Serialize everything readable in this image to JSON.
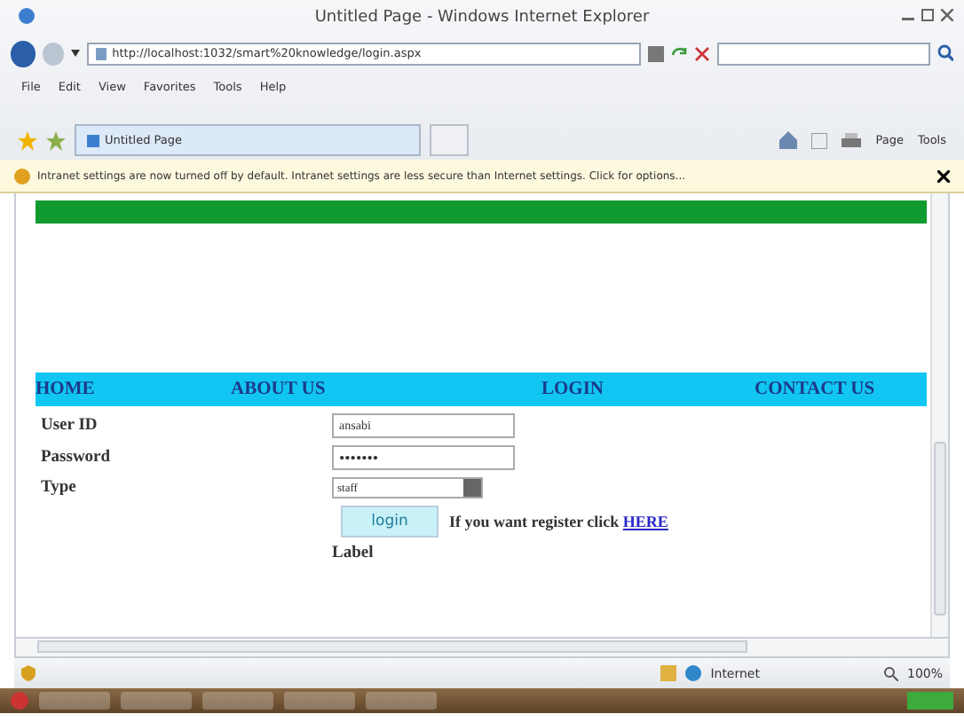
{
  "window": {
    "title": "Untitled Page - Windows Internet Explorer"
  },
  "address_bar": {
    "url": "http://localhost:1032/smart%20knowledge/login.aspx"
  },
  "menu": [
    "File",
    "Edit",
    "View",
    "Favorites",
    "Tools",
    "Help"
  ],
  "tab": {
    "title": "Untitled Page",
    "selected": true
  },
  "command_bar": [
    "Page",
    "Tools"
  ],
  "info_bar": {
    "message": "Intranet settings are now turned off by default. Intranet settings are less secure than Internet settings. Click for options..."
  },
  "page": {
    "nav": [
      "HOME",
      "ABOUT US",
      "LOGIN",
      "CONTACT US"
    ],
    "fields": [
      {
        "label": "User ID",
        "kind": "text",
        "value": "ansabi"
      },
      {
        "label": "Password",
        "kind": "password",
        "value": "•••••••"
      },
      {
        "label": "Type",
        "kind": "select",
        "value": "staff"
      }
    ],
    "button": "login",
    "register_text": "If you want register click",
    "register_link": "HERE",
    "status_label": "Label"
  },
  "status_bar": {
    "zone": "Internet",
    "zoom": "100%"
  }
}
